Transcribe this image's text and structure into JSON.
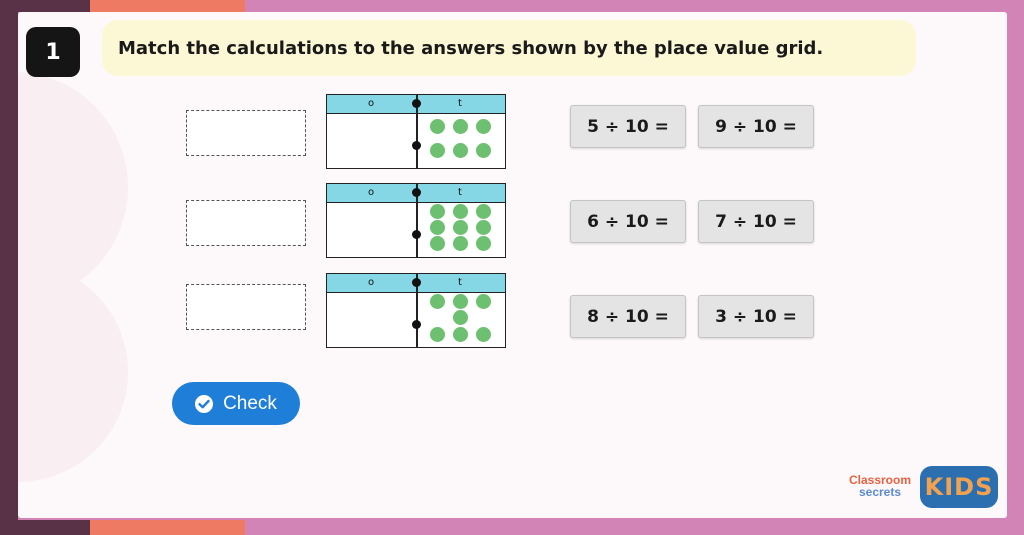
{
  "question": {
    "number": "1",
    "text": "Match the calculations to the answers shown by the place value grid."
  },
  "grids": [
    {
      "ones_header": "o",
      "tenths_header": "t",
      "tenths_value": 6
    },
    {
      "ones_header": "o",
      "tenths_header": "t",
      "tenths_value": 9
    },
    {
      "ones_header": "o",
      "tenths_header": "t",
      "tenths_value": 7
    }
  ],
  "calculations": [
    "5 ÷ 10 =",
    "9 ÷ 10 =",
    "6 ÷ 10 =",
    "7 ÷ 10 =",
    "8 ÷ 10 =",
    "3 ÷ 10 ="
  ],
  "check_button": {
    "label": "Check",
    "icon": "check-circle-icon"
  },
  "logo": {
    "line1": "Classroom",
    "line2": "secrets",
    "kids": "KIDS"
  },
  "colors": {
    "header_cyan": "#86d7e6",
    "counter_green": "#6cc070",
    "button_blue": "#1f7fd8",
    "banner_yellow": "#fcf8d5"
  }
}
